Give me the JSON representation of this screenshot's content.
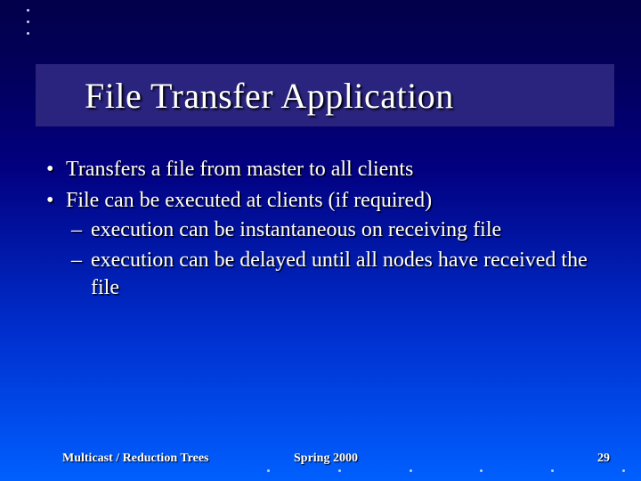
{
  "title": "File Transfer Application",
  "bullets": {
    "b1": "Transfers a file from master to all clients",
    "b2": "File can be executed at clients (if required)",
    "b2_sub1": "execution can be instantaneous on receiving file",
    "b2_sub2": "execution can be delayed until all nodes have received the file"
  },
  "footer": {
    "left": "Multicast / Reduction Trees",
    "center": "Spring 2000",
    "right": "29"
  }
}
